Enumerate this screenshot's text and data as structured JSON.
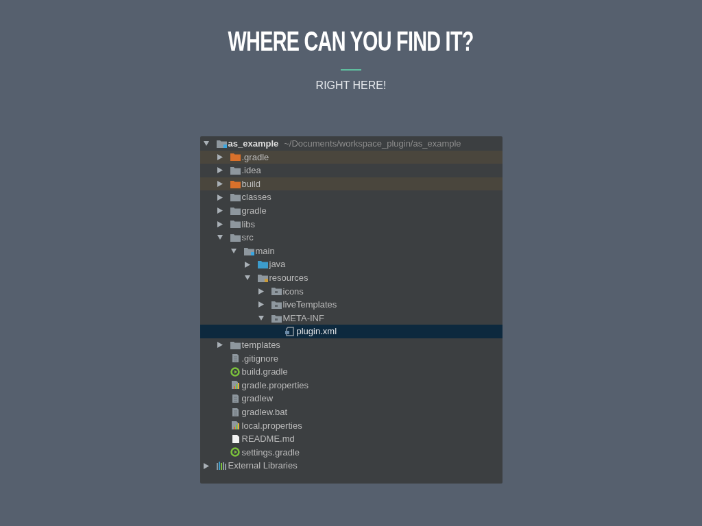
{
  "slide": {
    "title": "WHERE CAN YOU FIND IT?",
    "subtitle": "RIGHT HERE!"
  },
  "tree": [
    {
      "label": "as_example",
      "path": "~/Documents/workspace_plugin/as_example",
      "kind": "module",
      "expanded": true,
      "selected": false,
      "children": [
        {
          "label": ".gradle",
          "kind": "excluded",
          "expanded": false,
          "selected": false
        },
        {
          "label": ".idea",
          "kind": "folder",
          "expanded": false,
          "selected": false
        },
        {
          "label": "build",
          "kind": "excluded",
          "expanded": false,
          "selected": false
        },
        {
          "label": "classes",
          "kind": "folder",
          "expanded": false,
          "selected": false
        },
        {
          "label": "gradle",
          "kind": "folder",
          "expanded": false,
          "selected": false
        },
        {
          "label": "libs",
          "kind": "folder",
          "expanded": false,
          "selected": false
        },
        {
          "label": "src",
          "kind": "folder",
          "expanded": true,
          "selected": false,
          "children": [
            {
              "label": "main",
              "kind": "module",
              "expanded": true,
              "selected": false,
              "children": [
                {
                  "label": "java",
                  "kind": "source",
                  "expanded": false,
                  "selected": false
                },
                {
                  "label": "resources",
                  "kind": "resources",
                  "expanded": true,
                  "selected": false,
                  "children": [
                    {
                      "label": "icons",
                      "kind": "package",
                      "expanded": false,
                      "selected": false
                    },
                    {
                      "label": "liveTemplates",
                      "kind": "package",
                      "expanded": false,
                      "selected": false
                    },
                    {
                      "label": "META-INF",
                      "kind": "package",
                      "expanded": true,
                      "selected": false,
                      "children": [
                        {
                          "label": "plugin.xml",
                          "kind": "xml",
                          "selected": true
                        }
                      ]
                    }
                  ]
                }
              ]
            }
          ]
        },
        {
          "label": "templates",
          "kind": "folder",
          "expanded": false,
          "selected": false
        },
        {
          "label": ".gitignore",
          "kind": "file",
          "selected": false
        },
        {
          "label": "build.gradle",
          "kind": "gradle",
          "selected": false
        },
        {
          "label": "gradle.properties",
          "kind": "properties",
          "selected": false
        },
        {
          "label": "gradlew",
          "kind": "file",
          "selected": false
        },
        {
          "label": "gradlew.bat",
          "kind": "file",
          "selected": false
        },
        {
          "label": "local.properties",
          "kind": "properties",
          "selected": false
        },
        {
          "label": "README.md",
          "kind": "markdown",
          "selected": false
        },
        {
          "label": "settings.gradle",
          "kind": "gradle",
          "selected": false
        }
      ]
    },
    {
      "label": "External Libraries",
      "kind": "libraries",
      "expanded": false,
      "selected": false
    }
  ]
}
